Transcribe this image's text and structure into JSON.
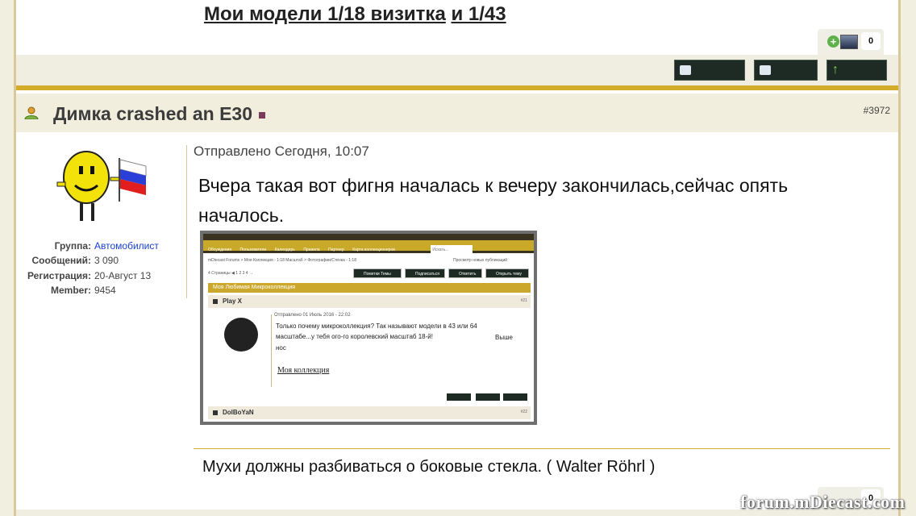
{
  "previous_post": {
    "signature_link_1": "Мои модели 1/18 визитка",
    "signature_link_2": "и 1/43",
    "reputation_count": "0"
  },
  "post": {
    "author": "Димка crashed an E30",
    "post_number": "#3972",
    "user_info": {
      "group_label": "Группа:",
      "group_value": "Автомобилист",
      "posts_label": "Сообщений:",
      "posts_value": "3 090",
      "registered_label": "Регистрация:",
      "registered_value": "20-Август 13",
      "member_label": "Member:",
      "member_value": "9454"
    },
    "posted": "Отправлено Сегодня, 10:07",
    "text": "Вчера такая вот фигня началась к вечеру закончилась,сейчас опять началось.",
    "signature": "Мухи должны разбиваться о боковые стекла. ( Walter Röhrl )",
    "reputation_count": "0"
  },
  "embedded_screenshot": {
    "nav_items": [
      "Обсуждения",
      "Пользователи",
      "Календарь",
      "Правила",
      "Партнер",
      "Карта коллекционеров"
    ],
    "search_placeholder": "Искать...",
    "breadcrumb": "mDiecast Forums > Моя Коллекция - 1:18 Масштаб > Фотографии/Стенка - 1:18",
    "view_new": "Просмотр новых публикаций",
    "pages": "4 Страницы ◀ 1 2 3 4 →",
    "buttons": [
      "Пометки Темы",
      "Подписаться",
      "Ответить",
      "Открыть тему"
    ],
    "topic_bar": "Моя Любимая Микроколлекция",
    "post1_author": "Play X",
    "post1_num": "#21",
    "post1_posted": "Отправлено 01 Июль 2016 - 22:02",
    "post1_line1": "Только почему микроколлекция? Так называют модели в 43 или 64",
    "post1_line2": "масштабе...у тебя ого-го королевский масштаб 18-й!",
    "post1_line3": "нос",
    "post1_above": "Выше",
    "post1_link": "Моя коллекция",
    "post2_author": "DolBoYaN",
    "post2_num": "#22"
  },
  "watermark": "forum.mDiecast.com",
  "colors": {
    "accent_gold": "#d2ac2a",
    "header_bg": "#f1eedd",
    "link_blue": "#1a3fd3"
  }
}
